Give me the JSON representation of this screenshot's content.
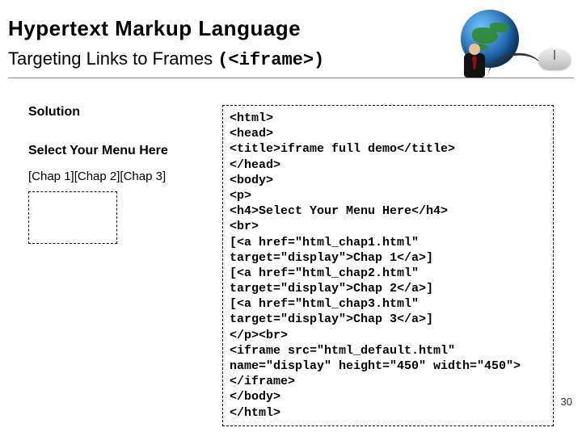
{
  "title": {
    "main": "Hypertext Markup Language",
    "sub_prefix": "Targeting Links to Frames ",
    "sub_code": "(<iframe>)"
  },
  "left": {
    "solution": "Solution",
    "menu_title": "Select Your Menu Here",
    "menu_links": "[Chap 1][Chap 2][Chap 3]"
  },
  "code": "<html>\n<head>\n<title>iframe full demo</title>\n</head>\n<body>\n<p>\n<h4>Select Your Menu Here</h4>\n<br>\n[<a href=\"html_chap1.html\" target=\"display\">Chap 1</a>]\n[<a href=\"html_chap2.html\" target=\"display\">Chap 2</a>]\n[<a href=\"html_chap3.html\" target=\"display\">Chap 3</a>]\n</p><br>\n<iframe src=\"html_default.html\" name=\"display\" height=\"450\" width=\"450\"></iframe>\n</body>\n</html>",
  "page_number": "30"
}
